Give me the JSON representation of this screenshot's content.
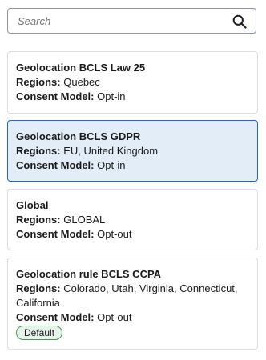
{
  "search": {
    "placeholder": "Search",
    "value": ""
  },
  "records": [
    {
      "title": "Geolocation BCLS Law 25",
      "regions_label": "Regions:",
      "regions": "Quebec",
      "consent_label": "Consent Model:",
      "consent": "Opt-in",
      "selected": false
    },
    {
      "title": "Geolocation BCLS GDPR",
      "regions_label": "Regions:",
      "regions": "EU, United Kingdom",
      "consent_label": "Consent Model:",
      "consent": "Opt-in",
      "selected": true
    },
    {
      "title": "Global",
      "regions_label": "Regions:",
      "regions": "GLOBAL",
      "consent_label": "Consent Model:",
      "consent": "Opt-out",
      "selected": false
    },
    {
      "title": "Geolocation rule BCLS CCPA",
      "regions_label": "Regions:",
      "regions": "Colorado, Utah, Virginia, Connecticut, California",
      "consent_label": "Consent Model:",
      "consent": "Opt-out",
      "badge": "Default",
      "selected": false
    }
  ],
  "colors": {
    "selected_background": "#e3edf7",
    "selected_border": "#1b6ac9",
    "badge_background": "#e6f2ea",
    "badge_border": "#3d9a59"
  },
  "icons": {
    "search": "search-icon"
  }
}
